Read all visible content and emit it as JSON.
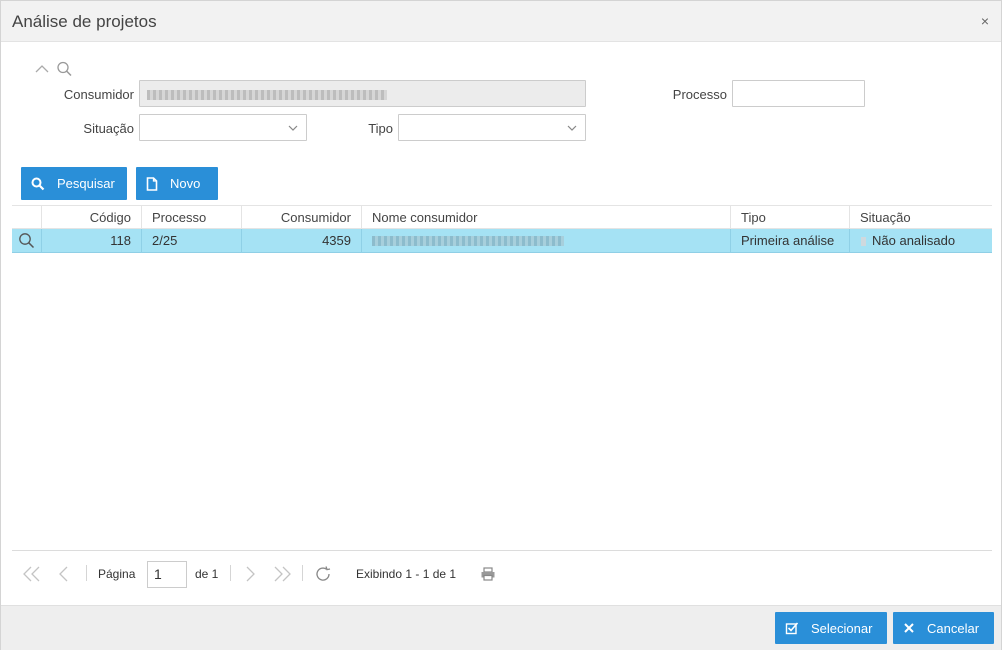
{
  "dialog": {
    "title": "Análise de projetos",
    "close_glyph": "×"
  },
  "filters": {
    "consumidor_label": "Consumidor",
    "processo_label": "Processo",
    "situacao_label": "Situação",
    "tipo_label": "Tipo",
    "processo_value": "",
    "situacao_value": "",
    "tipo_value": ""
  },
  "toolbar": {
    "search_label": "Pesquisar",
    "new_label": "Novo"
  },
  "grid": {
    "columns": [
      "Código",
      "Processo",
      "Consumidor",
      "Nome consumidor",
      "Tipo",
      "Situação"
    ],
    "rows": [
      {
        "codigo": "118",
        "processo": "2/25",
        "consumidor": "4359",
        "tipo": "Primeira análise",
        "situacao": "Não analisado"
      }
    ]
  },
  "pager": {
    "page_label": "Página",
    "page_value": "1",
    "of_label": "de 1",
    "display_text": "Exibindo 1 - 1 de 1"
  },
  "footer": {
    "select_label": "Selecionar",
    "cancel_label": "Cancelar"
  },
  "colors": {
    "accent": "#2a8fd8",
    "row_selected": "#a5e2f4"
  }
}
